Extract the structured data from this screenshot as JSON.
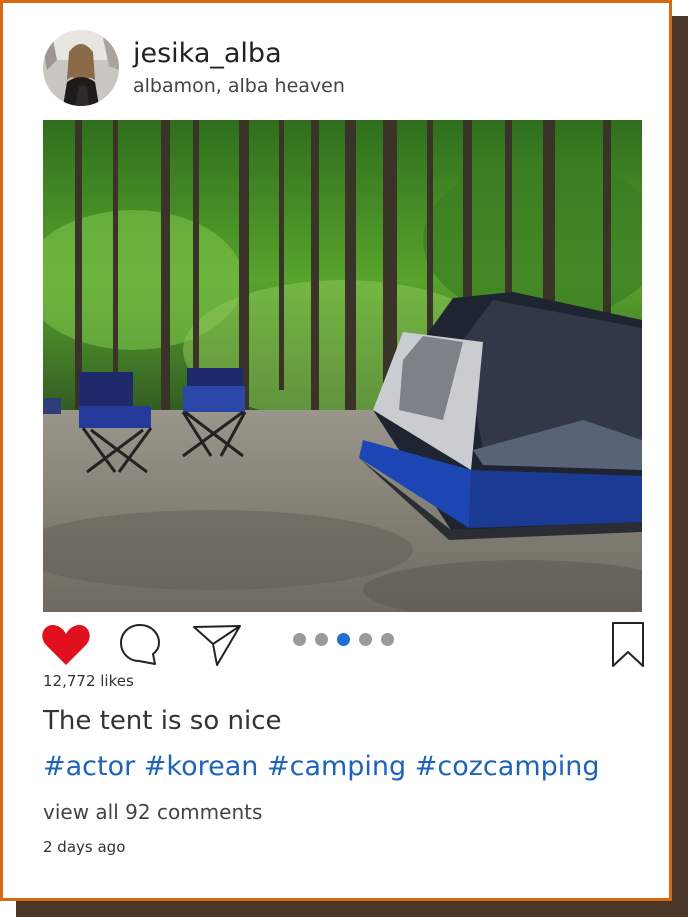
{
  "post": {
    "username": "jesika_alba",
    "location": "albamon, alba heaven",
    "likes": "12,772 likes",
    "caption": "The tent is so nice",
    "hashtags": "#actor #korean #camping #cozcamping",
    "comments_link": "view all 92 comments",
    "timestamp": "2 days ago",
    "liked": true,
    "carousel": {
      "count": 5,
      "active_index": 2
    }
  },
  "icons": {
    "like": "heart-filled-icon",
    "comment": "speech-bubble-icon",
    "share": "paper-plane-icon",
    "bookmark": "bookmark-icon"
  },
  "colors": {
    "frame": "#d9680f",
    "shadow": "#4a3727",
    "like": "#e0101e",
    "hashtag": "#1d64b8",
    "active_dot": "#1d6fd4",
    "inactive_dot": "#9a9a9a"
  }
}
